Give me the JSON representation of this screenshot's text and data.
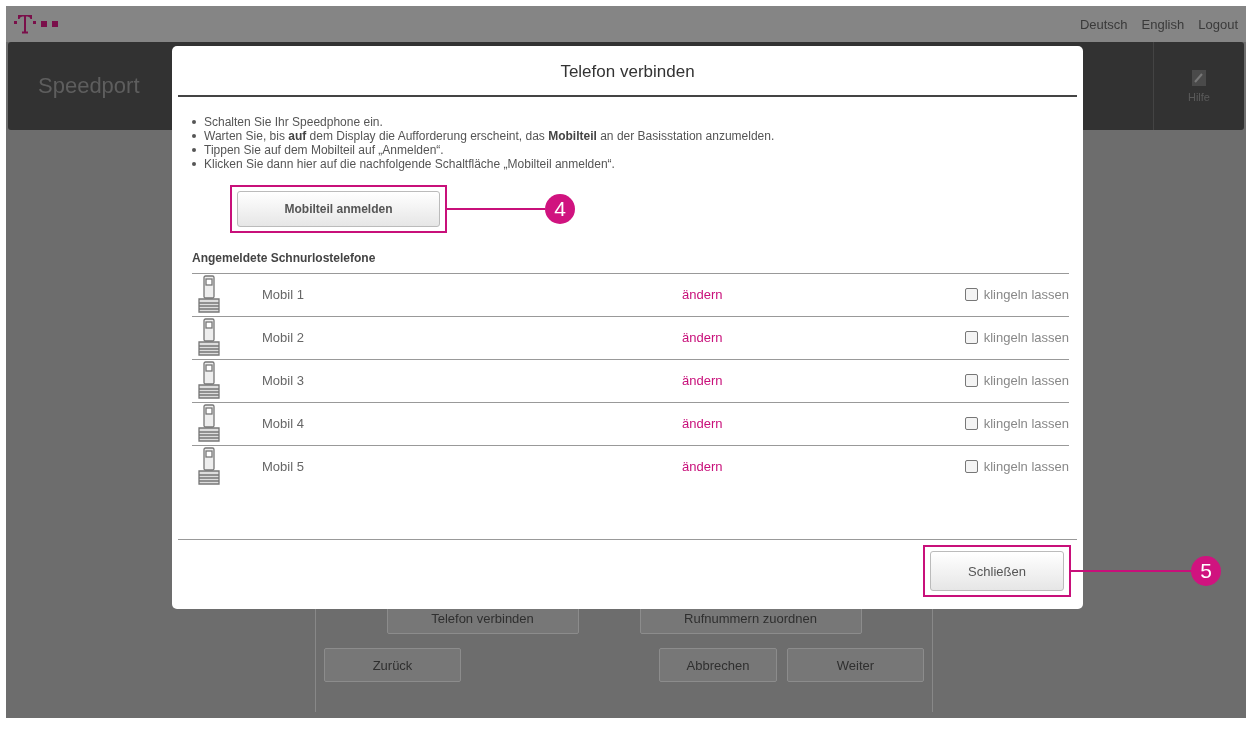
{
  "header": {
    "languages": [
      {
        "label": "Deutsch"
      },
      {
        "label": "English"
      }
    ],
    "logout": "Logout",
    "brand": "Speedport",
    "help": "Hilfe"
  },
  "background_panel": {
    "buttons": [
      "Telefon verbinden",
      "Rufnummern zuordnen"
    ],
    "nav": [
      "Zurück",
      "Abbrechen",
      "Weiter"
    ]
  },
  "dialog": {
    "title": "Telefon verbinden",
    "instructions": [
      "Schalten Sie Ihr Speedphone ein.",
      "Warten Sie, bis **auf** dem Display die Aufforderung erscheint, das **Mobilteil** an der Basisstation anzumelden.",
      "Tippen Sie auf dem Mobilteil auf „Anmelden“.",
      "Klicken Sie dann hier auf die nachfolgende Schaltfläche „Mobilteil anmelden“."
    ],
    "register_button": {
      "label": "Mobilteil anmelden",
      "callout": "4"
    },
    "section_title": "Angemeldete Schnurlostelefone",
    "handsets": [
      {
        "name": "Mobil 1",
        "action": "ändern",
        "ring_label": "klingeln lassen",
        "checked": false
      },
      {
        "name": "Mobil 2",
        "action": "ändern",
        "ring_label": "klingeln lassen",
        "checked": false
      },
      {
        "name": "Mobil 3",
        "action": "ändern",
        "ring_label": "klingeln lassen",
        "checked": false
      },
      {
        "name": "Mobil 4",
        "action": "ändern",
        "ring_label": "klingeln lassen",
        "checked": false
      },
      {
        "name": "Mobil 5",
        "action": "ändern",
        "ring_label": "klingeln lassen",
        "checked": false
      }
    ],
    "close_button": {
      "label": "Schließen",
      "callout": "5"
    }
  }
}
